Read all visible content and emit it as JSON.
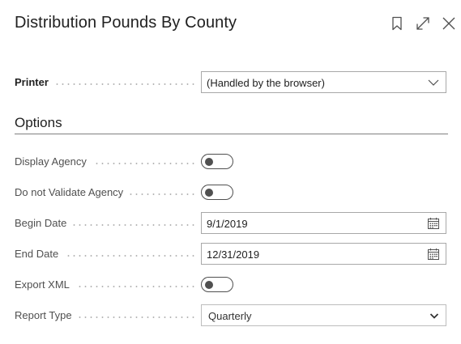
{
  "dialog": {
    "title": "Distribution Pounds By County",
    "icons": [
      "bookmark-icon",
      "expand-icon",
      "close-icon"
    ]
  },
  "printer": {
    "label": "Printer",
    "value": "(Handled by the browser)"
  },
  "options": {
    "heading": "Options",
    "display_agency": {
      "label": "Display Agency",
      "on": false
    },
    "do_not_validate_agency": {
      "label": "Do not Validate Agency",
      "on": false
    },
    "begin_date": {
      "label": "Begin Date",
      "value": "9/1/2019"
    },
    "end_date": {
      "label": "End Date",
      "value": "12/31/2019"
    },
    "export_xml": {
      "label": "Export XML",
      "on": false
    },
    "report_type": {
      "label": "Report Type",
      "value": "Quarterly"
    }
  }
}
